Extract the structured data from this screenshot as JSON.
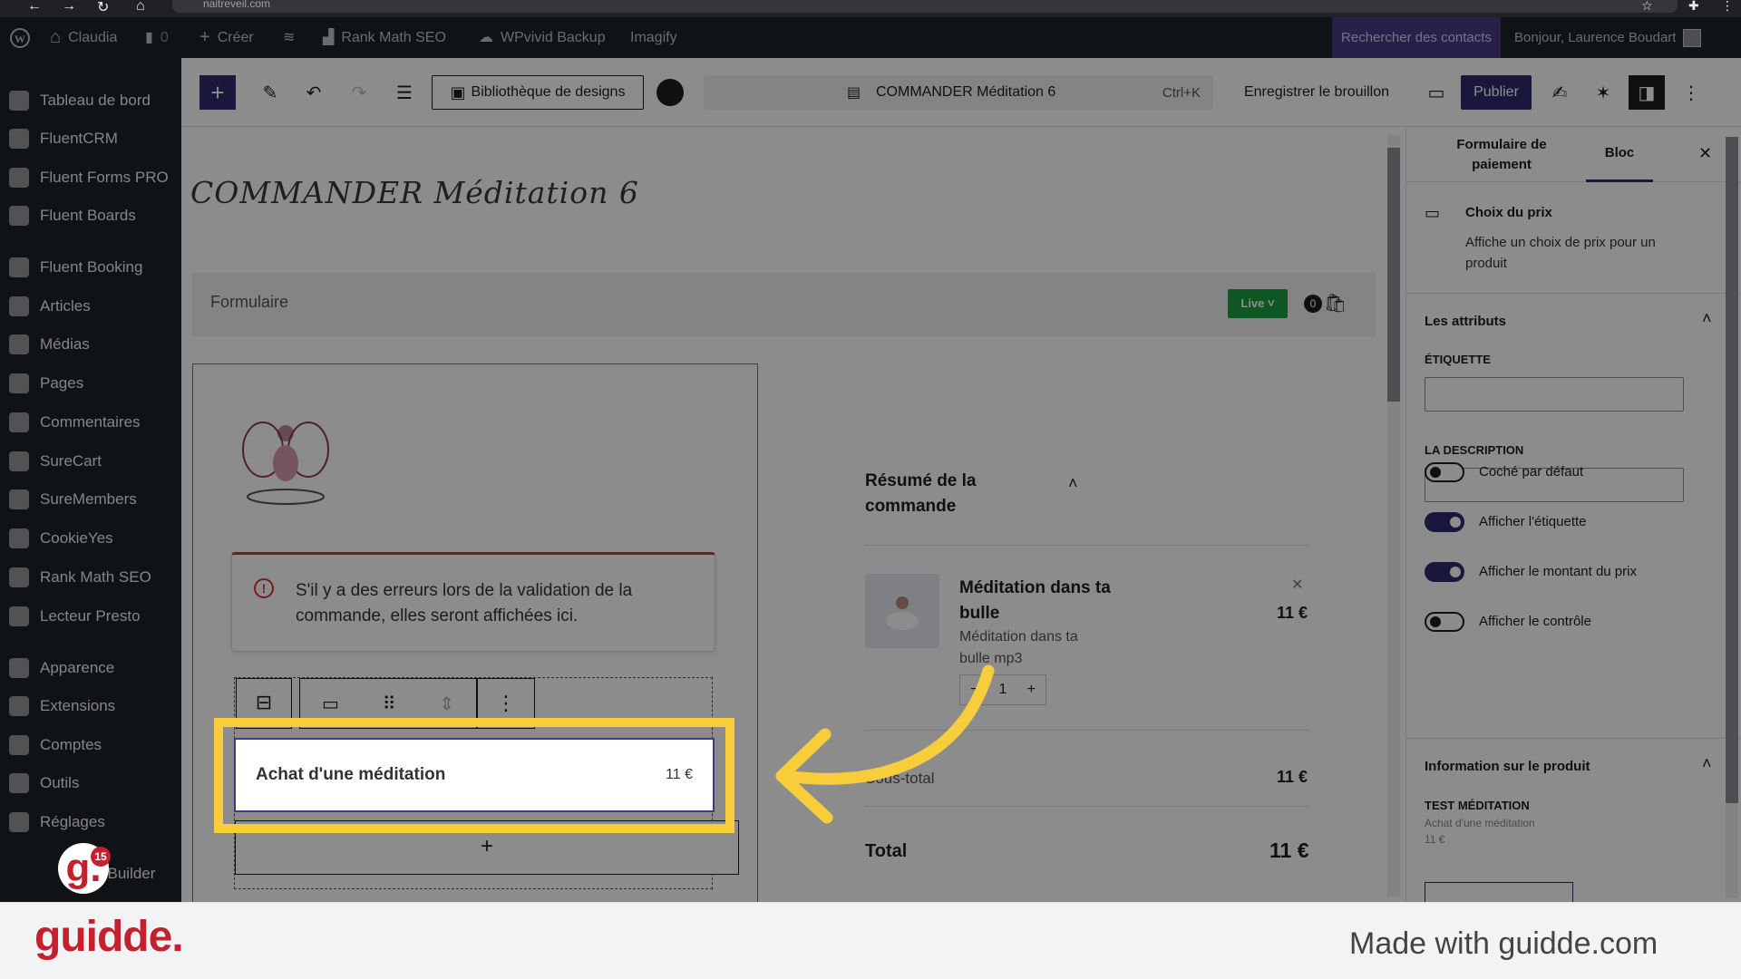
{
  "browser": {
    "url": "naitreveil.com"
  },
  "adminbar": {
    "site_name": "Claudia",
    "comments_count": "0",
    "new_label": "Créer",
    "rank_math": "Rank Math SEO",
    "wpvivid": "WPvivid Backup",
    "imagify": "Imagify",
    "search_contacts": "Rechercher des contacts",
    "greeting": "Bonjour, Laurence Boudart"
  },
  "sidebar": {
    "items": [
      {
        "label": "Tableau de bord",
        "icon": "dashboard-icon"
      },
      {
        "label": "FluentCRM",
        "icon": "fluentcrm-icon"
      },
      {
        "label": "Fluent Forms PRO",
        "icon": "forms-icon"
      },
      {
        "label": "Fluent Boards",
        "icon": "boards-icon"
      },
      {
        "label": "Fluent Booking",
        "icon": "booking-icon"
      },
      {
        "label": "Articles",
        "icon": "pin-icon"
      },
      {
        "label": "Médias",
        "icon": "media-icon"
      },
      {
        "label": "Pages",
        "icon": "pages-icon"
      },
      {
        "label": "Commentaires",
        "icon": "comment-icon"
      },
      {
        "label": "SureCart",
        "icon": "surecart-icon"
      },
      {
        "label": "SureMembers",
        "icon": "suremembers-icon"
      },
      {
        "label": "CookieYes",
        "icon": "cookie-icon"
      },
      {
        "label": "Rank Math SEO",
        "icon": "rankmath-icon"
      },
      {
        "label": "Lecteur Presto",
        "icon": "player-icon"
      },
      {
        "label": "Apparence",
        "icon": "brush-icon"
      },
      {
        "label": "Extensions",
        "icon": "plugin-icon"
      },
      {
        "label": "Comptes",
        "icon": "user-icon"
      },
      {
        "label": "Outils",
        "icon": "wrench-icon"
      },
      {
        "label": "Réglages",
        "icon": "settings-icon"
      }
    ],
    "partial_item": "zBuilder",
    "badge_count": "15"
  },
  "toolbar": {
    "design_library": "Bibliothèque de designs",
    "doc_title": "COMMANDER Méditation 6",
    "shortcut": "Ctrl+K",
    "save_draft": "Enregistrer le brouillon",
    "publish": "Publier"
  },
  "canvas": {
    "page_title": "COMMANDER Méditation 6",
    "form_label": "Formulaire",
    "live_badge": "Live",
    "cart_count": "0",
    "error_notice": "S'il y a des erreurs lors de la validation de la commande, elles seront affichées ici.",
    "price_choice_label": "Achat d'une méditation",
    "price_choice_amount": "11 €",
    "add_block": "+",
    "summary": {
      "title": "Résumé de la commande",
      "item_name": "Méditation dans ta bulle",
      "item_desc": "Méditation dans ta bulle mp3",
      "item_price": "11 €",
      "qty": "1",
      "subtotal_label": "Sous-total",
      "subtotal_value": "11 €",
      "total_label": "Total",
      "total_value": "11 €"
    }
  },
  "panel": {
    "tab_form": "Formulaire de paiement",
    "tab_block": "Bloc",
    "block_name": "Choix du prix",
    "block_desc": "Affiche un choix de prix pour un produit",
    "attributes_title": "Les attributs",
    "label_field": "ÉTIQUETTE",
    "desc_field": "LA DESCRIPTION",
    "toggles": [
      {
        "label": "Coché par défaut",
        "on": false
      },
      {
        "label": "Afficher l'étiquette",
        "on": true
      },
      {
        "label": "Afficher le montant du prix",
        "on": true
      },
      {
        "label": "Afficher le contrôle",
        "on": false
      }
    ],
    "product_info_title": "Information sur le produit",
    "product_name": "TEST MÉDITATION",
    "product_price_name": "Achat d'une méditation",
    "product_price": "11 €"
  },
  "footer": {
    "logo": "guidde.",
    "made_with": "Made with guidde.com"
  },
  "colors": {
    "wp_dark": "#1d2327",
    "highlight": "#f8cd3c",
    "accent": "#2f2d6d",
    "guidde_red": "#c4202d",
    "live_green": "#1a9f3e"
  }
}
